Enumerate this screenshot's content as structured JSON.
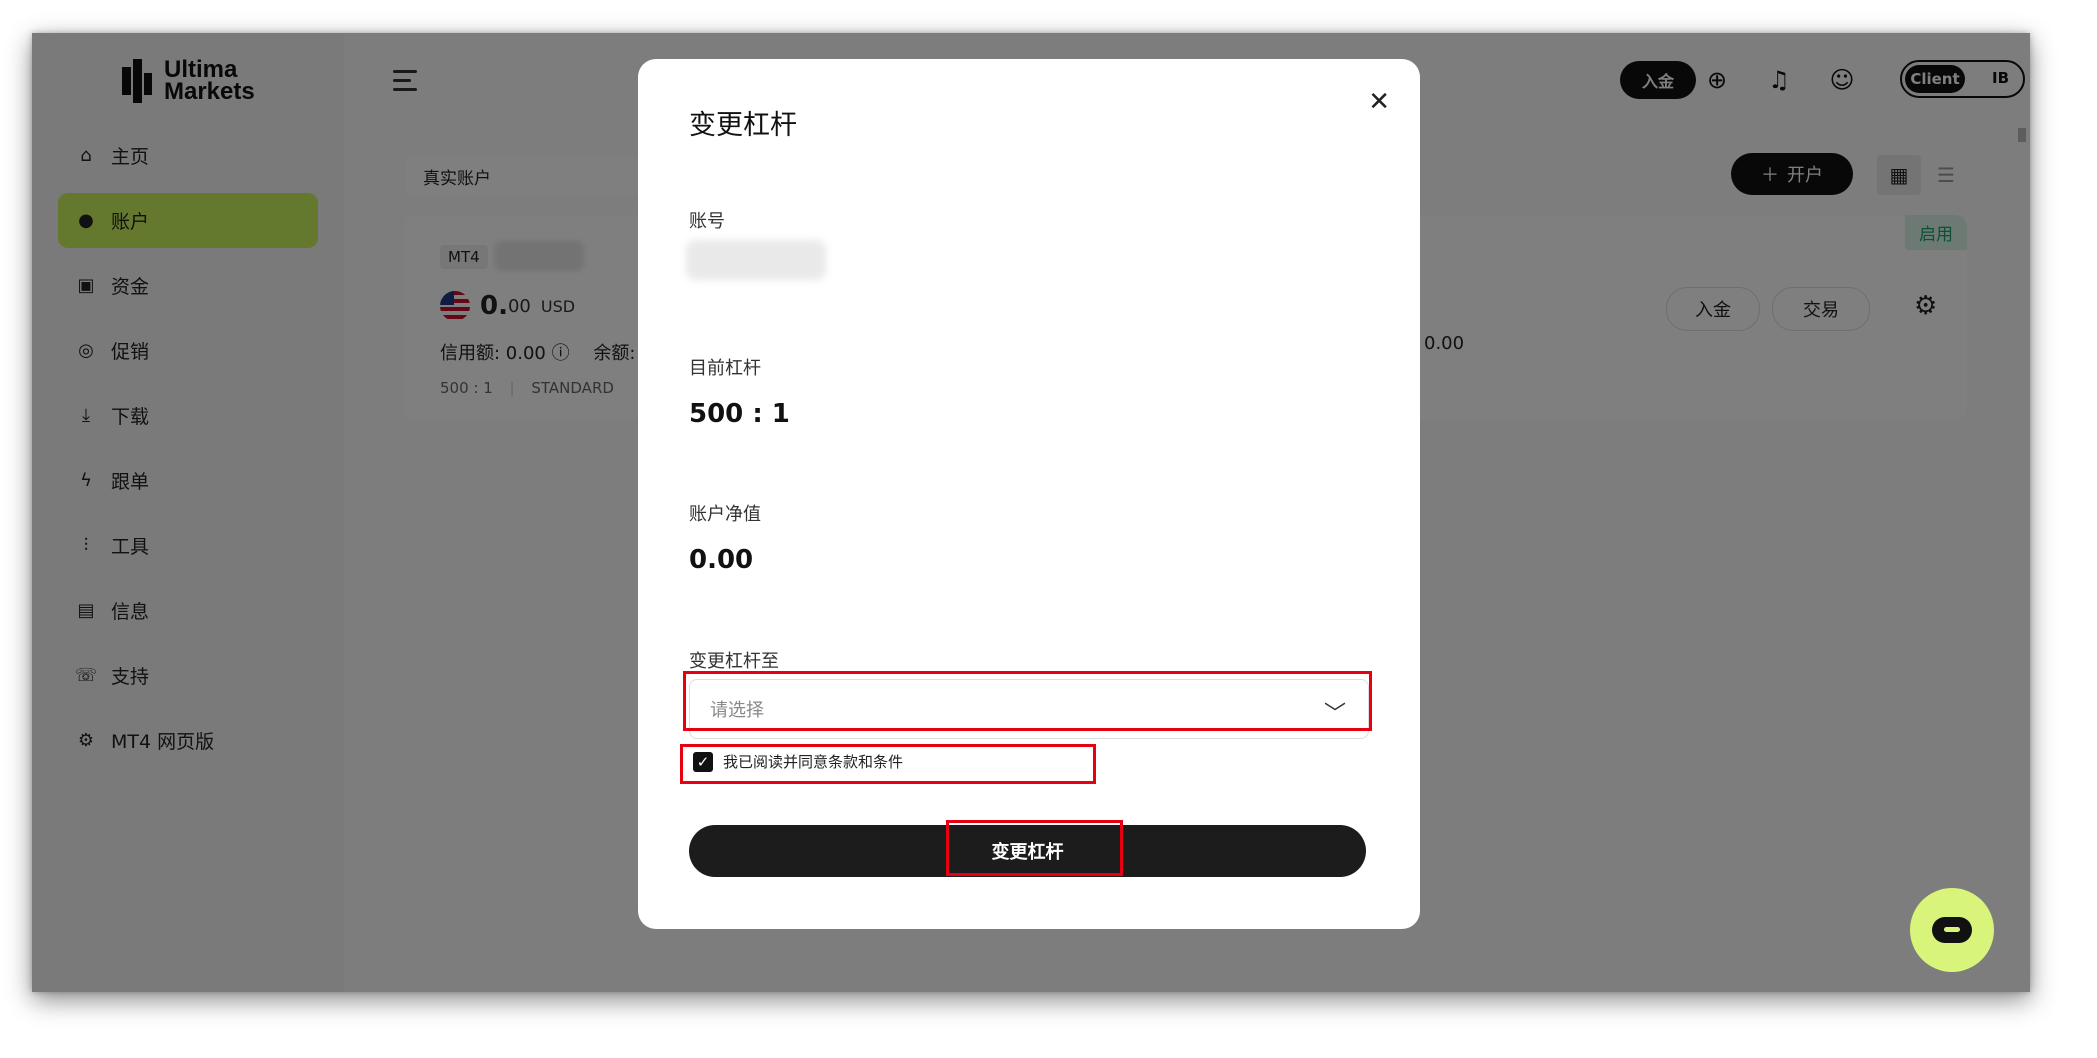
{
  "brand": {
    "line1": "Ultima",
    "line2": "Markets"
  },
  "sidebar": {
    "items": [
      {
        "label": "主页",
        "icon": "home-icon"
      },
      {
        "label": "账户",
        "icon": "user-icon",
        "active": true
      },
      {
        "label": "资金",
        "icon": "wallet-icon"
      },
      {
        "label": "促销",
        "icon": "promo-icon"
      },
      {
        "label": "下载",
        "icon": "download-icon"
      },
      {
        "label": "跟单",
        "icon": "copy-trade-icon"
      },
      {
        "label": "工具",
        "icon": "tools-icon"
      },
      {
        "label": "信息",
        "icon": "info-icon"
      },
      {
        "label": "支持",
        "icon": "support-icon"
      },
      {
        "label": "MT4 网页版",
        "icon": "mt4-web-icon"
      }
    ]
  },
  "topbar": {
    "deposit_label": "入金",
    "toggle_client": "Client",
    "toggle_ib": "IB"
  },
  "toolbar": {
    "account_type": "真实账户",
    "open_account_label": "开户"
  },
  "card": {
    "platform": "MT4",
    "balance_int": "0.",
    "balance_dec": "00",
    "currency": "USD",
    "credit_label": "信用额: 0.00 ⓘ",
    "balance_label": "余额: ",
    "right_value": "0.00",
    "leverage": "500 : 1",
    "type": "STANDARD",
    "status": "启用",
    "deposit_label": "入金",
    "trade_label": "交易"
  },
  "modal": {
    "title": "变更杠杆",
    "account_label": "账号",
    "current_leverage_label": "目前杠杆",
    "current_leverage_value": "500 : 1",
    "equity_label": "账户净值",
    "equity_value": "0.00",
    "change_to_label": "变更杠杆至",
    "select_placeholder": "请选择",
    "agree_label": "我已阅读并同意条款和条件",
    "agree_checked": true,
    "submit_label": "变更杠杆"
  },
  "colors": {
    "accent": "#c9f25c",
    "highlight": "#e60012",
    "dark": "#1c1c1c",
    "status": "#1aa36b"
  }
}
